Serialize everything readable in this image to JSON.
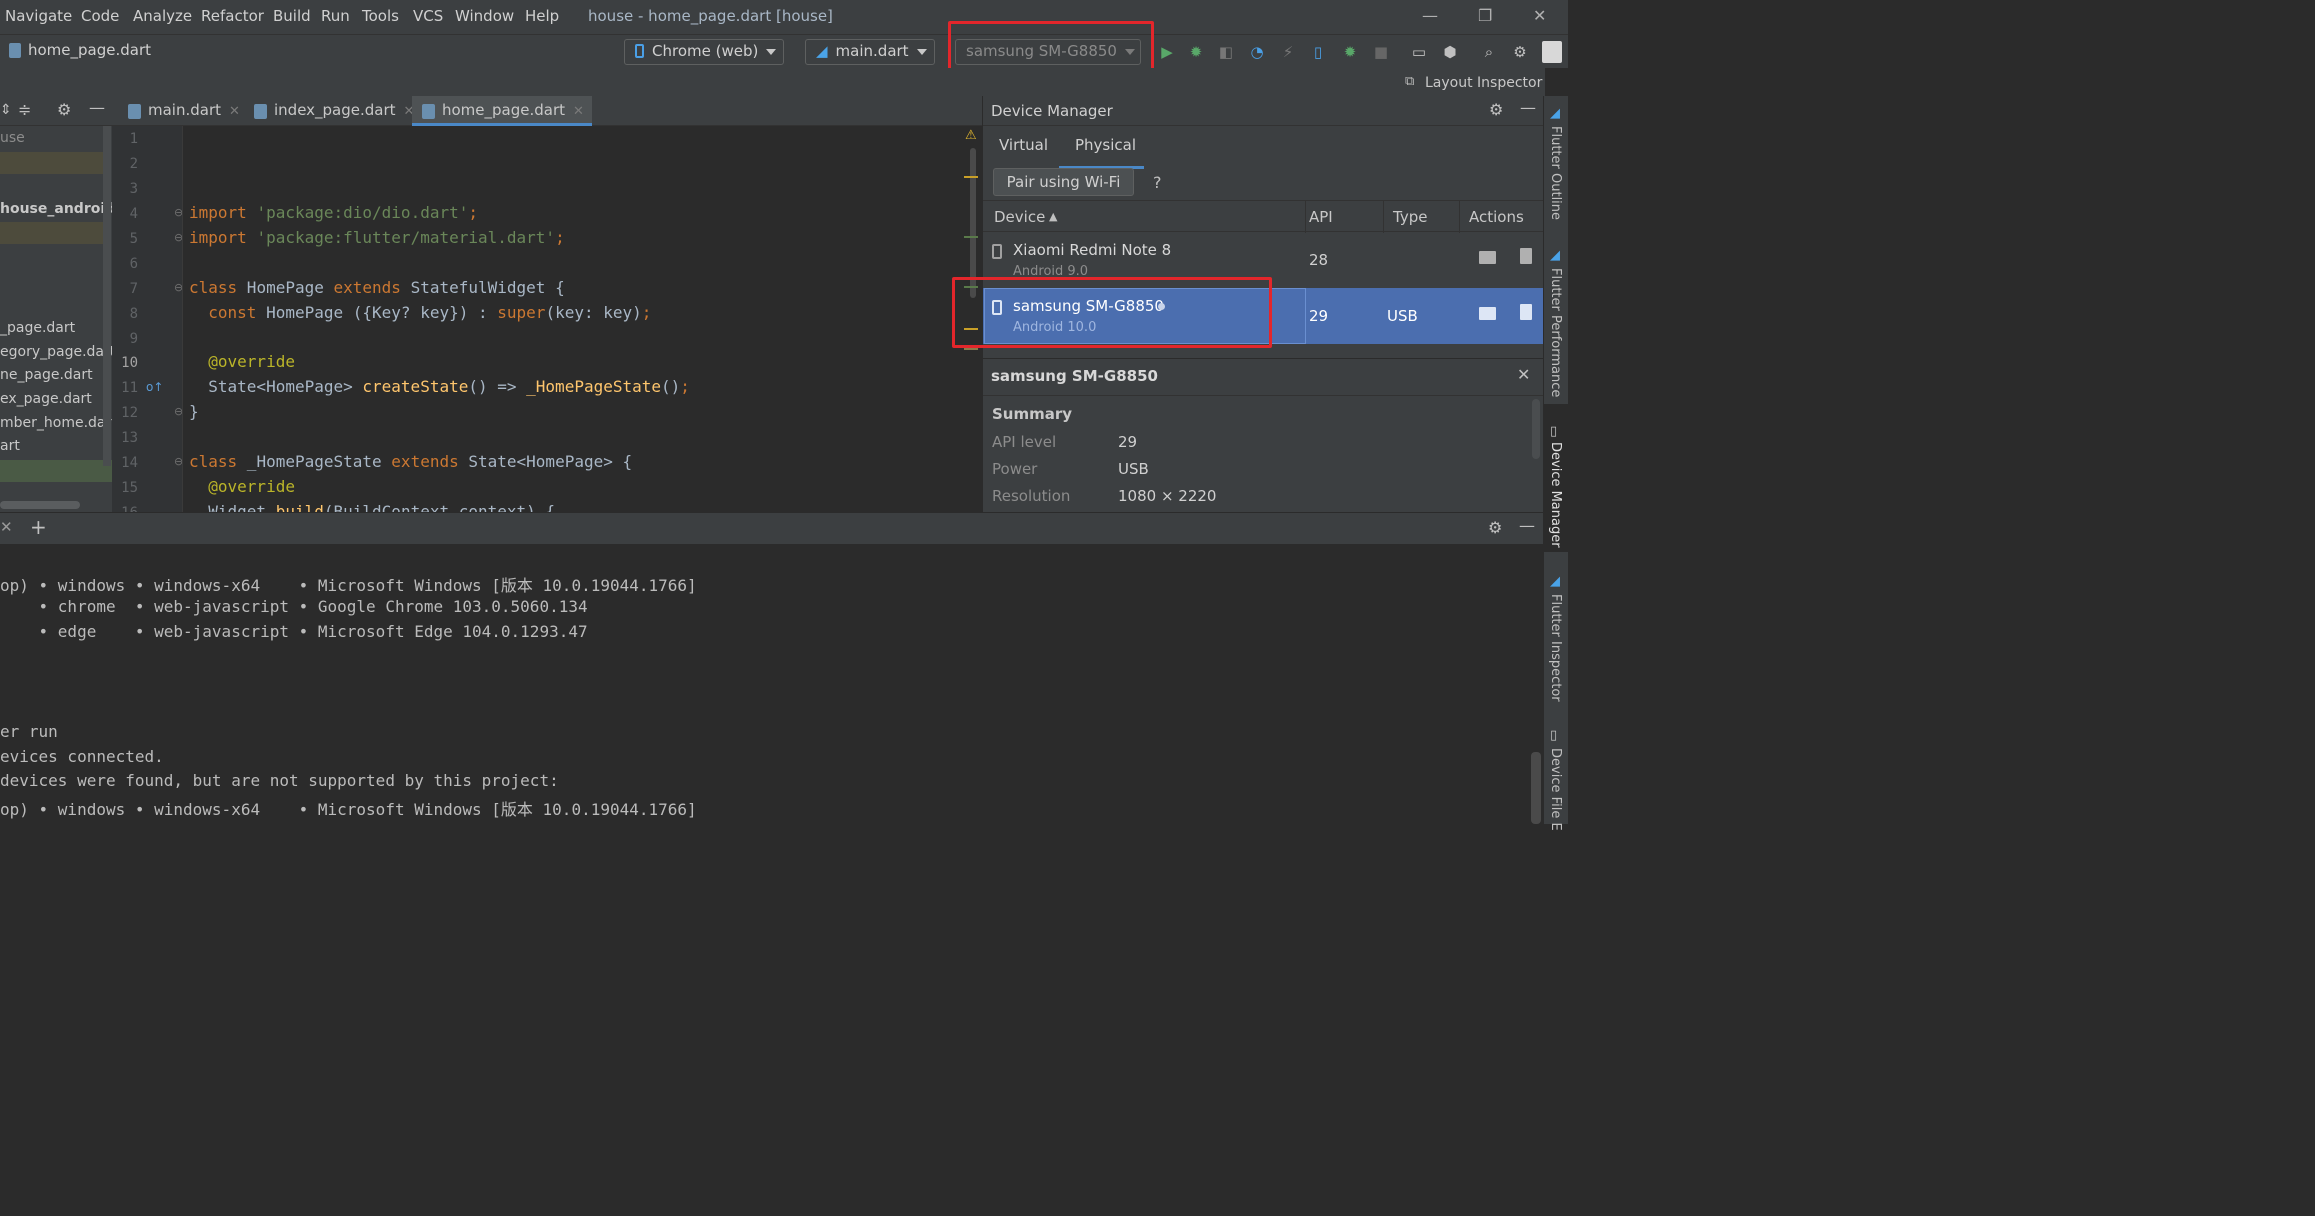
{
  "menubar": {
    "items": [
      "Navigate",
      "Code",
      "Analyze",
      "Refactor",
      "Build",
      "Run",
      "Tools",
      "VCS",
      "Window",
      "Help"
    ],
    "window_title": "house - home_page.dart [house]"
  },
  "toolbar": {
    "breadcrumb_file": "home_page.dart",
    "device_web": "Chrome (web)",
    "run_config": "main.dart",
    "device_selected": "samsung SM-G8850"
  },
  "navrow": {
    "layout_inspector": "Layout Inspector"
  },
  "project": {
    "items": [
      "use",
      "house_android]",
      "_page.dart",
      "egory_page.dart",
      "ne_page.dart",
      "ex_page.dart",
      "mber_home.dart",
      "art"
    ]
  },
  "editor": {
    "tabs": [
      "main.dart",
      "index_page.dart",
      "home_page.dart"
    ],
    "line_numbers": [
      "1",
      "2",
      "3",
      "4",
      "5",
      "6",
      "7",
      "8",
      "9",
      "10",
      "11",
      "12",
      "13",
      "14",
      "15",
      "16"
    ]
  },
  "device_manager": {
    "title": "Device Manager",
    "tabs": [
      "Virtual",
      "Physical"
    ],
    "pair_button": "Pair using Wi-Fi",
    "help": "?",
    "columns": [
      "Device",
      "API",
      "Type",
      "Actions"
    ],
    "devices": [
      {
        "name": "Xiaomi Redmi Note 8",
        "sub": "Android 9.0",
        "api": "28",
        "type": ""
      },
      {
        "name": "samsung SM-G8850",
        "sub": "Android 10.0",
        "api": "29",
        "type": "USB"
      }
    ],
    "detail": {
      "title": "samsung SM-G8850",
      "summary": "Summary",
      "rows": [
        {
          "label": "API level",
          "value": "29"
        },
        {
          "label": "Power",
          "value": "USB"
        },
        {
          "label": "Resolution",
          "value": "1080 × 2220"
        }
      ]
    }
  },
  "right_stripe": [
    "Flutter Outline",
    "Flutter Performance",
    "Device Manager",
    "Flutter Inspector",
    "Device File E"
  ],
  "terminal": {
    "lines": [
      "op) • windows • windows-x64    • Microsoft Windows [版本 10.0.19044.1766]",
      "    • chrome  • web-javascript • Google Chrome 103.0.5060.134",
      "    • edge    • web-javascript • Microsoft Edge 104.0.1293.47",
      "",
      "",
      "",
      "er run",
      "evices connected.",
      "devices were found, but are not supported by this project:",
      "op) • windows • windows-x64    • Microsoft Windows [版本 10.0.19044.1766]"
    ]
  }
}
